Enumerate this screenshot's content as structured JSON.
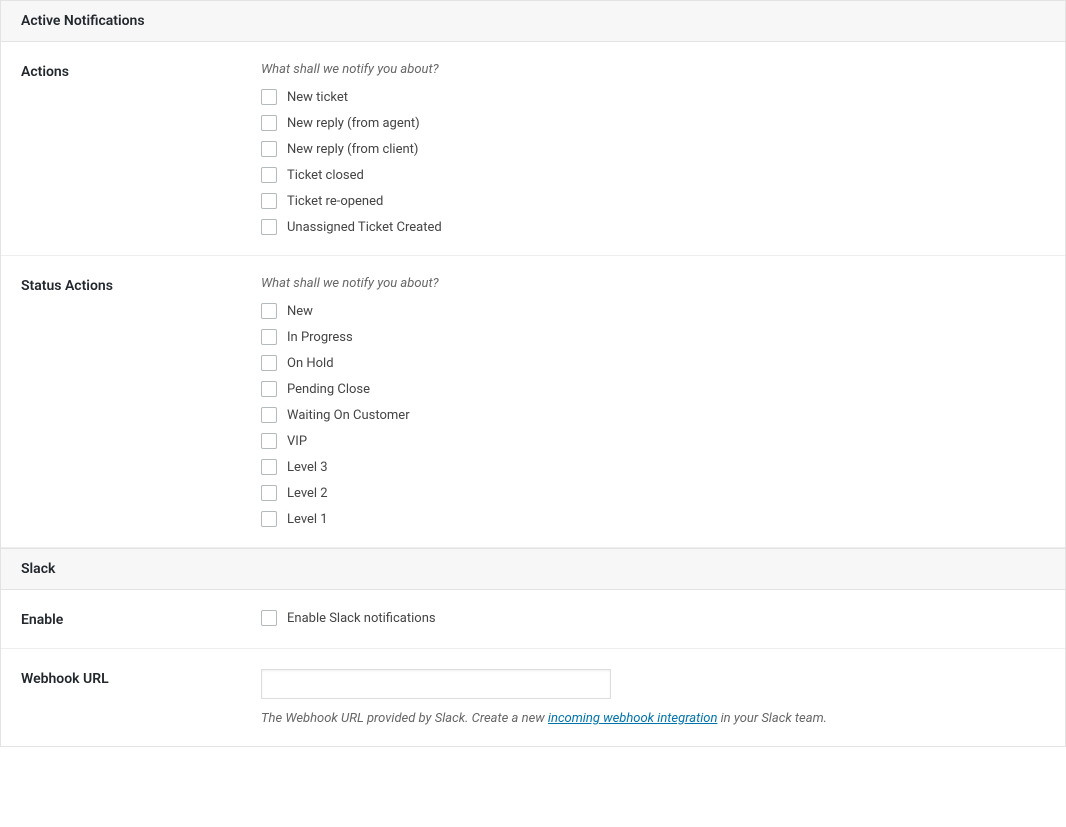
{
  "sections": {
    "activeNotifications": {
      "title": "Active Notifications",
      "actions": {
        "label": "Actions",
        "prompt": "What shall we notify you about?",
        "items": [
          "New ticket",
          "New reply (from agent)",
          "New reply (from client)",
          "Ticket closed",
          "Ticket re-opened",
          "Unassigned Ticket Created"
        ]
      },
      "statusActions": {
        "label": "Status Actions",
        "prompt": "What shall we notify you about?",
        "items": [
          "New",
          "In Progress",
          "On Hold",
          "Pending Close",
          "Waiting On Customer",
          "VIP",
          "Level 3",
          "Level 2",
          "Level 1"
        ]
      }
    },
    "slack": {
      "title": "Slack",
      "enable": {
        "label": "Enable",
        "checkboxLabel": "Enable Slack notifications"
      },
      "webhook": {
        "label": "Webhook URL",
        "value": "",
        "helpPrefix": "The Webhook URL provided by Slack. Create a new ",
        "helpLink": "incoming webhook integration",
        "helpSuffix": " in your Slack team."
      }
    }
  }
}
